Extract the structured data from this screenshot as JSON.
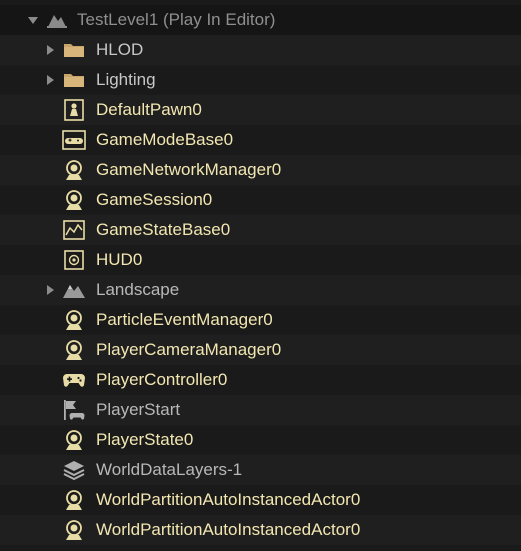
{
  "world": {
    "label": "TestLevel1 (Play In Editor)"
  },
  "items": [
    {
      "label": "HLOD",
      "icon": "folder-icon",
      "expandable": true,
      "type": "folder"
    },
    {
      "label": "Lighting",
      "icon": "folder-icon",
      "expandable": true,
      "type": "folder"
    },
    {
      "label": "DefaultPawn0",
      "icon": "pawn-icon",
      "expandable": false,
      "type": "actor"
    },
    {
      "label": "GameModeBase0",
      "icon": "game-mode-icon",
      "expandable": false,
      "type": "actor"
    },
    {
      "label": "GameNetworkManager0",
      "icon": "info-actor-icon",
      "expandable": false,
      "type": "actor"
    },
    {
      "label": "GameSession0",
      "icon": "info-actor-icon",
      "expandable": false,
      "type": "actor"
    },
    {
      "label": "GameStateBase0",
      "icon": "game-state-icon",
      "expandable": false,
      "type": "actor"
    },
    {
      "label": "HUD0",
      "icon": "hud-icon",
      "expandable": false,
      "type": "actor"
    },
    {
      "label": "Landscape",
      "icon": "landscape-icon",
      "expandable": true,
      "type": "gray"
    },
    {
      "label": "ParticleEventManager0",
      "icon": "info-actor-icon",
      "expandable": false,
      "type": "actor"
    },
    {
      "label": "PlayerCameraManager0",
      "icon": "info-actor-icon",
      "expandable": false,
      "type": "actor"
    },
    {
      "label": "PlayerController0",
      "icon": "gamepad-icon",
      "expandable": false,
      "type": "actor"
    },
    {
      "label": "PlayerStart",
      "icon": "player-start-icon",
      "expandable": false,
      "type": "gray"
    },
    {
      "label": "PlayerState0",
      "icon": "info-actor-icon",
      "expandable": false,
      "type": "actor"
    },
    {
      "label": "WorldDataLayers-1",
      "icon": "layers-icon",
      "expandable": false,
      "type": "gray"
    },
    {
      "label": "WorldPartitionAutoInstancedActor0",
      "icon": "info-actor-icon",
      "expandable": false,
      "type": "actor"
    },
    {
      "label": "WorldPartitionAutoInstancedActor0",
      "icon": "info-actor-icon",
      "expandable": false,
      "type": "actor"
    }
  ],
  "colors": {
    "background": "#1a1a1a",
    "actor_text": "#f2e6b1",
    "folder_text": "#c7c7c7",
    "folder_icon": "#c8a46a",
    "actor_icon": "#e8dca6"
  }
}
